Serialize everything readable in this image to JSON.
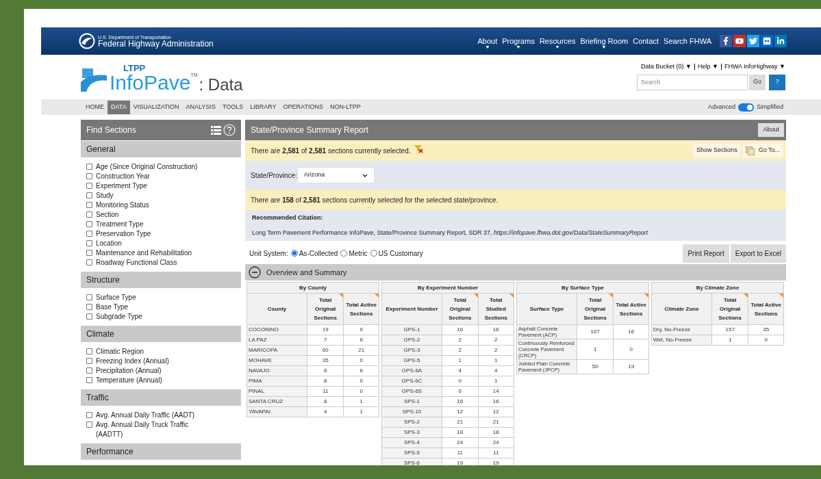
{
  "agency": {
    "line1": "U.S. Department of Transportation",
    "line2": "Federal Highway Administration"
  },
  "top_nav": [
    {
      "label": "About",
      "has_menu": true
    },
    {
      "label": "Programs",
      "has_menu": true
    },
    {
      "label": "Resources",
      "has_menu": true
    },
    {
      "label": "Briefing Room",
      "has_menu": true
    },
    {
      "label": "Contact",
      "has_menu": false
    },
    {
      "label": "Search FHWA",
      "has_menu": false
    }
  ],
  "social": [
    {
      "kind": "facebook",
      "color": "#3b5998"
    },
    {
      "kind": "youtube",
      "color": "#c4302b"
    },
    {
      "kind": "twitter",
      "color": "#1da1f2"
    },
    {
      "kind": "flickr",
      "color": "#0063dc"
    },
    {
      "kind": "linkedin",
      "color": "#0077b5"
    }
  ],
  "logo": {
    "small": "LTPP",
    "big": "InfoPave",
    "tm": "TM",
    "suffix": ": Data"
  },
  "utility_links": [
    "Data Bucket (0) ▼",
    "Help ▼",
    "FHWA InfoHighway ▼"
  ],
  "search": {
    "placeholder": "Search",
    "go": "Go",
    "help": "?"
  },
  "tabs": [
    {
      "label": "HOME",
      "selected": false
    },
    {
      "label": "DATA",
      "selected": true
    },
    {
      "label": "VISUALIZATION",
      "selected": false
    },
    {
      "label": "ANALYSIS",
      "selected": false
    },
    {
      "label": "TOOLS",
      "selected": false
    },
    {
      "label": "LIBRARY",
      "selected": false
    },
    {
      "label": "OPERATIONS",
      "selected": false
    },
    {
      "label": "NON-LTPP",
      "selected": false
    }
  ],
  "mode_toggle": {
    "left": "Advanced",
    "right": "Simplified",
    "on": true
  },
  "sidebar": {
    "title": "Find Sections",
    "groups": [
      {
        "title": "General",
        "items": [
          {
            "label": "Age (Since Original Construction)",
            "checked": false
          },
          {
            "label": "Construction Year",
            "checked": false
          },
          {
            "label": "Experiment Type",
            "checked": false
          },
          {
            "label": "Study",
            "checked": false
          },
          {
            "label": "Monitoring Status",
            "checked": false
          },
          {
            "label": "Section",
            "checked": false
          },
          {
            "label": "Treatment Type",
            "checked": false
          },
          {
            "label": "Preservation Type",
            "checked": false
          },
          {
            "label": "Location",
            "checked": false
          },
          {
            "label": "Maintenance and Rehabilitation",
            "checked": false
          },
          {
            "label": "Roadway Functional Class",
            "checked": false
          }
        ]
      },
      {
        "title": "Structure",
        "items": [
          {
            "label": "Surface Type",
            "checked": false
          },
          {
            "label": "Base Type",
            "checked": false
          },
          {
            "label": "Subgrade Type",
            "checked": false
          }
        ]
      },
      {
        "title": "Climate",
        "items": [
          {
            "label": "Climatic Region",
            "checked": false
          },
          {
            "label": "Freezing Index (Annual)",
            "checked": false
          },
          {
            "label": "Precipitation (Annual)",
            "checked": false
          },
          {
            "label": "Temperature (Annual)",
            "checked": false
          }
        ]
      },
      {
        "title": "Traffic",
        "items": [
          {
            "label": "Avg. Annual Daily Traffic (AADT)",
            "checked": false
          },
          {
            "label": "Avg. Annual Daily Truck Traffic (AADTT)",
            "checked": false
          }
        ]
      },
      {
        "title": "Performance"
      }
    ]
  },
  "report": {
    "title": "State/Province Summary Report",
    "about": "About",
    "selection": "There are **2,581** of **2,581** sections currently selected.",
    "show_sections": "Show Sections",
    "go_to": "Go To...",
    "state_label": "State/Province:",
    "state_value": "Arizona",
    "state_selection": "There are **158** of **2,581** sections currently selected for the selected state/province.",
    "citation_label": "Recommended Citation:",
    "citation": "Long Term Pavement Performance InfoPave, State/Province Summary Report, SDR 37, *https://infopave.fhwa.dot.gov/Data/StateSummaryReport*",
    "unit_label": "Unit System:",
    "units": [
      {
        "label": "As-Collected",
        "selected": true
      },
      {
        "label": "Metric",
        "selected": false
      },
      {
        "label": "US Customary",
        "selected": false
      }
    ],
    "print": "Print Report",
    "export": "Export to Excel",
    "section": {
      "title": "Overview and Summary",
      "expanded": true
    }
  },
  "tables": [
    {
      "title": "By County",
      "columns": [
        {
          "label": "County",
          "flagged": false
        },
        {
          "label": "Total Original Sections",
          "flagged": true
        },
        {
          "label": "Total Active Sections",
          "flagged": true
        }
      ],
      "rows": [
        [
          "COCONINO",
          "19",
          "0"
        ],
        [
          "LA PAZ",
          "7",
          "6"
        ],
        [
          "MARICOPA",
          "60",
          "21"
        ],
        [
          "MOHAVE",
          "35",
          "0"
        ],
        [
          "NAVAJO",
          "6",
          "6"
        ],
        [
          "PIMA",
          "8",
          "0"
        ],
        [
          "PINAL",
          "11",
          "0"
        ],
        [
          "SANTA CRUZ",
          "8",
          "1"
        ],
        [
          "YAVAPAI",
          "4",
          "1"
        ]
      ]
    },
    {
      "title": "By Experiment Number",
      "columns": [
        {
          "label": "Experiment Number",
          "flagged": false
        },
        {
          "label": "Total Original Sections",
          "flagged": true
        },
        {
          "label": "Total Studied Sections",
          "flagged": true
        }
      ],
      "rows": [
        [
          "GPS-1",
          "16",
          "16"
        ],
        [
          "GPS-2",
          "2",
          "2"
        ],
        [
          "GPS-3",
          "2",
          "2"
        ],
        [
          "GPS-5",
          "1",
          "1"
        ],
        [
          "GPS-6A",
          "4",
          "4"
        ],
        [
          "GPS-6C",
          "0",
          "1"
        ],
        [
          "GPS-6S",
          "0",
          "14"
        ],
        [
          "SPS-1",
          "16",
          "16"
        ],
        [
          "SPS-10",
          "12",
          "12"
        ],
        [
          "SPS-2",
          "21",
          "21"
        ],
        [
          "SPS-3",
          "18",
          "18"
        ],
        [
          "SPS-4",
          "24",
          "24"
        ],
        [
          "SPS-5",
          "11",
          "11"
        ],
        [
          "SPS-6",
          "19",
          "19"
        ]
      ]
    },
    {
      "title": "By Surface Type",
      "columns": [
        {
          "label": "Surface Type",
          "flagged": false
        },
        {
          "label": "Total Original Sections",
          "flagged": true
        },
        {
          "label": "Total Active Sections",
          "flagged": true
        }
      ],
      "rows": [
        [
          "Asphalt Concrete Pavement (ACP)",
          "107",
          "16"
        ],
        [
          "Continuously Reinforced Concrete Pavement (CRCP)",
          "1",
          "0"
        ],
        [
          "Jointed Plain Concrete Pavement (JPCP)",
          "50",
          "19"
        ]
      ]
    },
    {
      "title": "By Climate Zone",
      "columns": [
        {
          "label": "Climate Zone",
          "flagged": false
        },
        {
          "label": "Total Original Sections",
          "flagged": true
        },
        {
          "label": "Total Active Sections",
          "flagged": true
        }
      ],
      "rows": [
        [
          "Dry, No-Freeze",
          "157",
          "35"
        ],
        [
          "Wet, No-Freeze",
          "1",
          "0"
        ]
      ]
    }
  ]
}
